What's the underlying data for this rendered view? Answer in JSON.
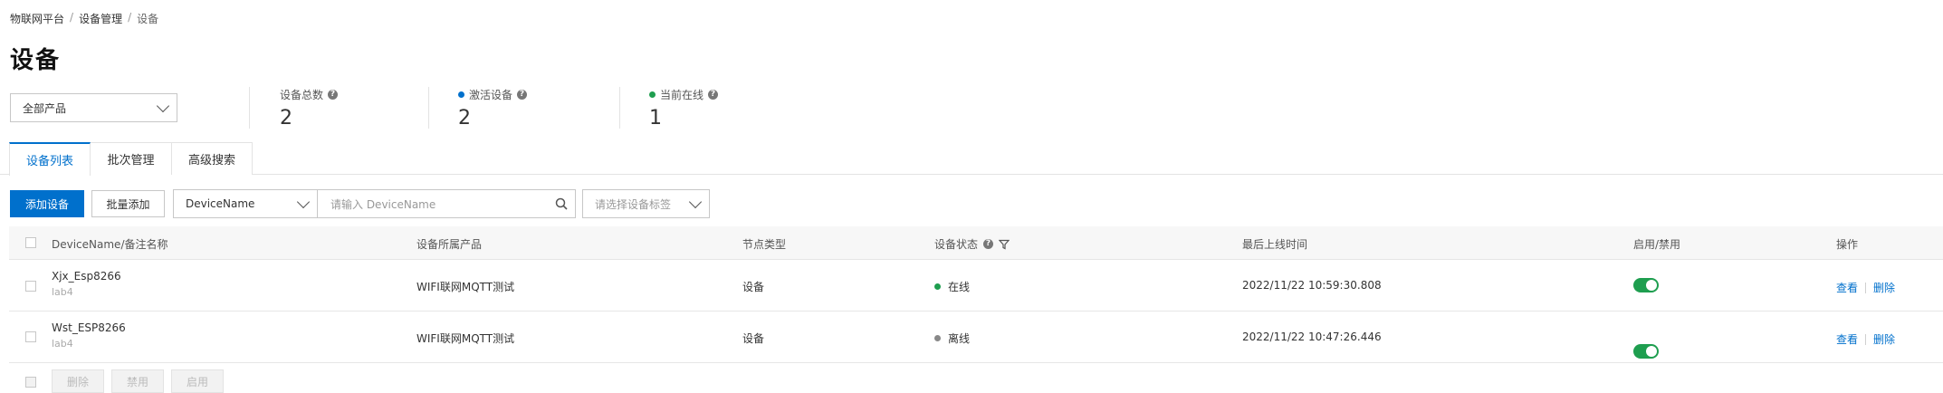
{
  "breadcrumb": {
    "items": [
      "物联网平台",
      "设备管理",
      "设备"
    ],
    "separator": "/"
  },
  "page_title": "设备",
  "product_select": {
    "value": "全部产品"
  },
  "stats": [
    {
      "label": "设备总数",
      "value": "2",
      "dot_color": null
    },
    {
      "label": "激活设备",
      "value": "2",
      "dot_color": "#0070cc"
    },
    {
      "label": "当前在线",
      "value": "1",
      "dot_color": "#1e9e4f"
    }
  ],
  "tabs": [
    {
      "label": "设备列表",
      "active": true
    },
    {
      "label": "批次管理",
      "active": false
    },
    {
      "label": "高级搜索",
      "active": false
    }
  ],
  "toolbar": {
    "add_device": "添加设备",
    "batch_add": "批量添加",
    "field_select": "DeviceName",
    "search_placeholder": "请输入 DeviceName",
    "tag_select_placeholder": "请选择设备标签"
  },
  "table": {
    "headers": {
      "name": "DeviceName/备注名称",
      "product": "设备所属产品",
      "node_type": "节点类型",
      "status": "设备状态",
      "last_online": "最后上线时间",
      "enable": "启用/禁用",
      "actions": "操作"
    },
    "rows": [
      {
        "name": "Xjx_Esp8266",
        "note": "lab4",
        "product": "WIFI联网MQTT测试",
        "node_type": "设备",
        "status": "在线",
        "status_color": "#1e9e4f",
        "last_online": "2022/11/22 10:59:30.808",
        "enabled": true,
        "view": "查看",
        "delete": "删除"
      },
      {
        "name": "Wst_ESP8266",
        "note": "lab4",
        "product": "WIFI联网MQTT测试",
        "node_type": "设备",
        "status": "离线",
        "status_color": "#888888",
        "last_online": "2022/11/22 10:47:26.446",
        "enabled": true,
        "view": "查看",
        "delete": "删除"
      }
    ]
  },
  "bulk_actions": [
    "删除",
    "禁用",
    "启用"
  ],
  "colors": {
    "primary": "#0070cc",
    "online": "#1e9e4f",
    "offline": "#888888"
  }
}
